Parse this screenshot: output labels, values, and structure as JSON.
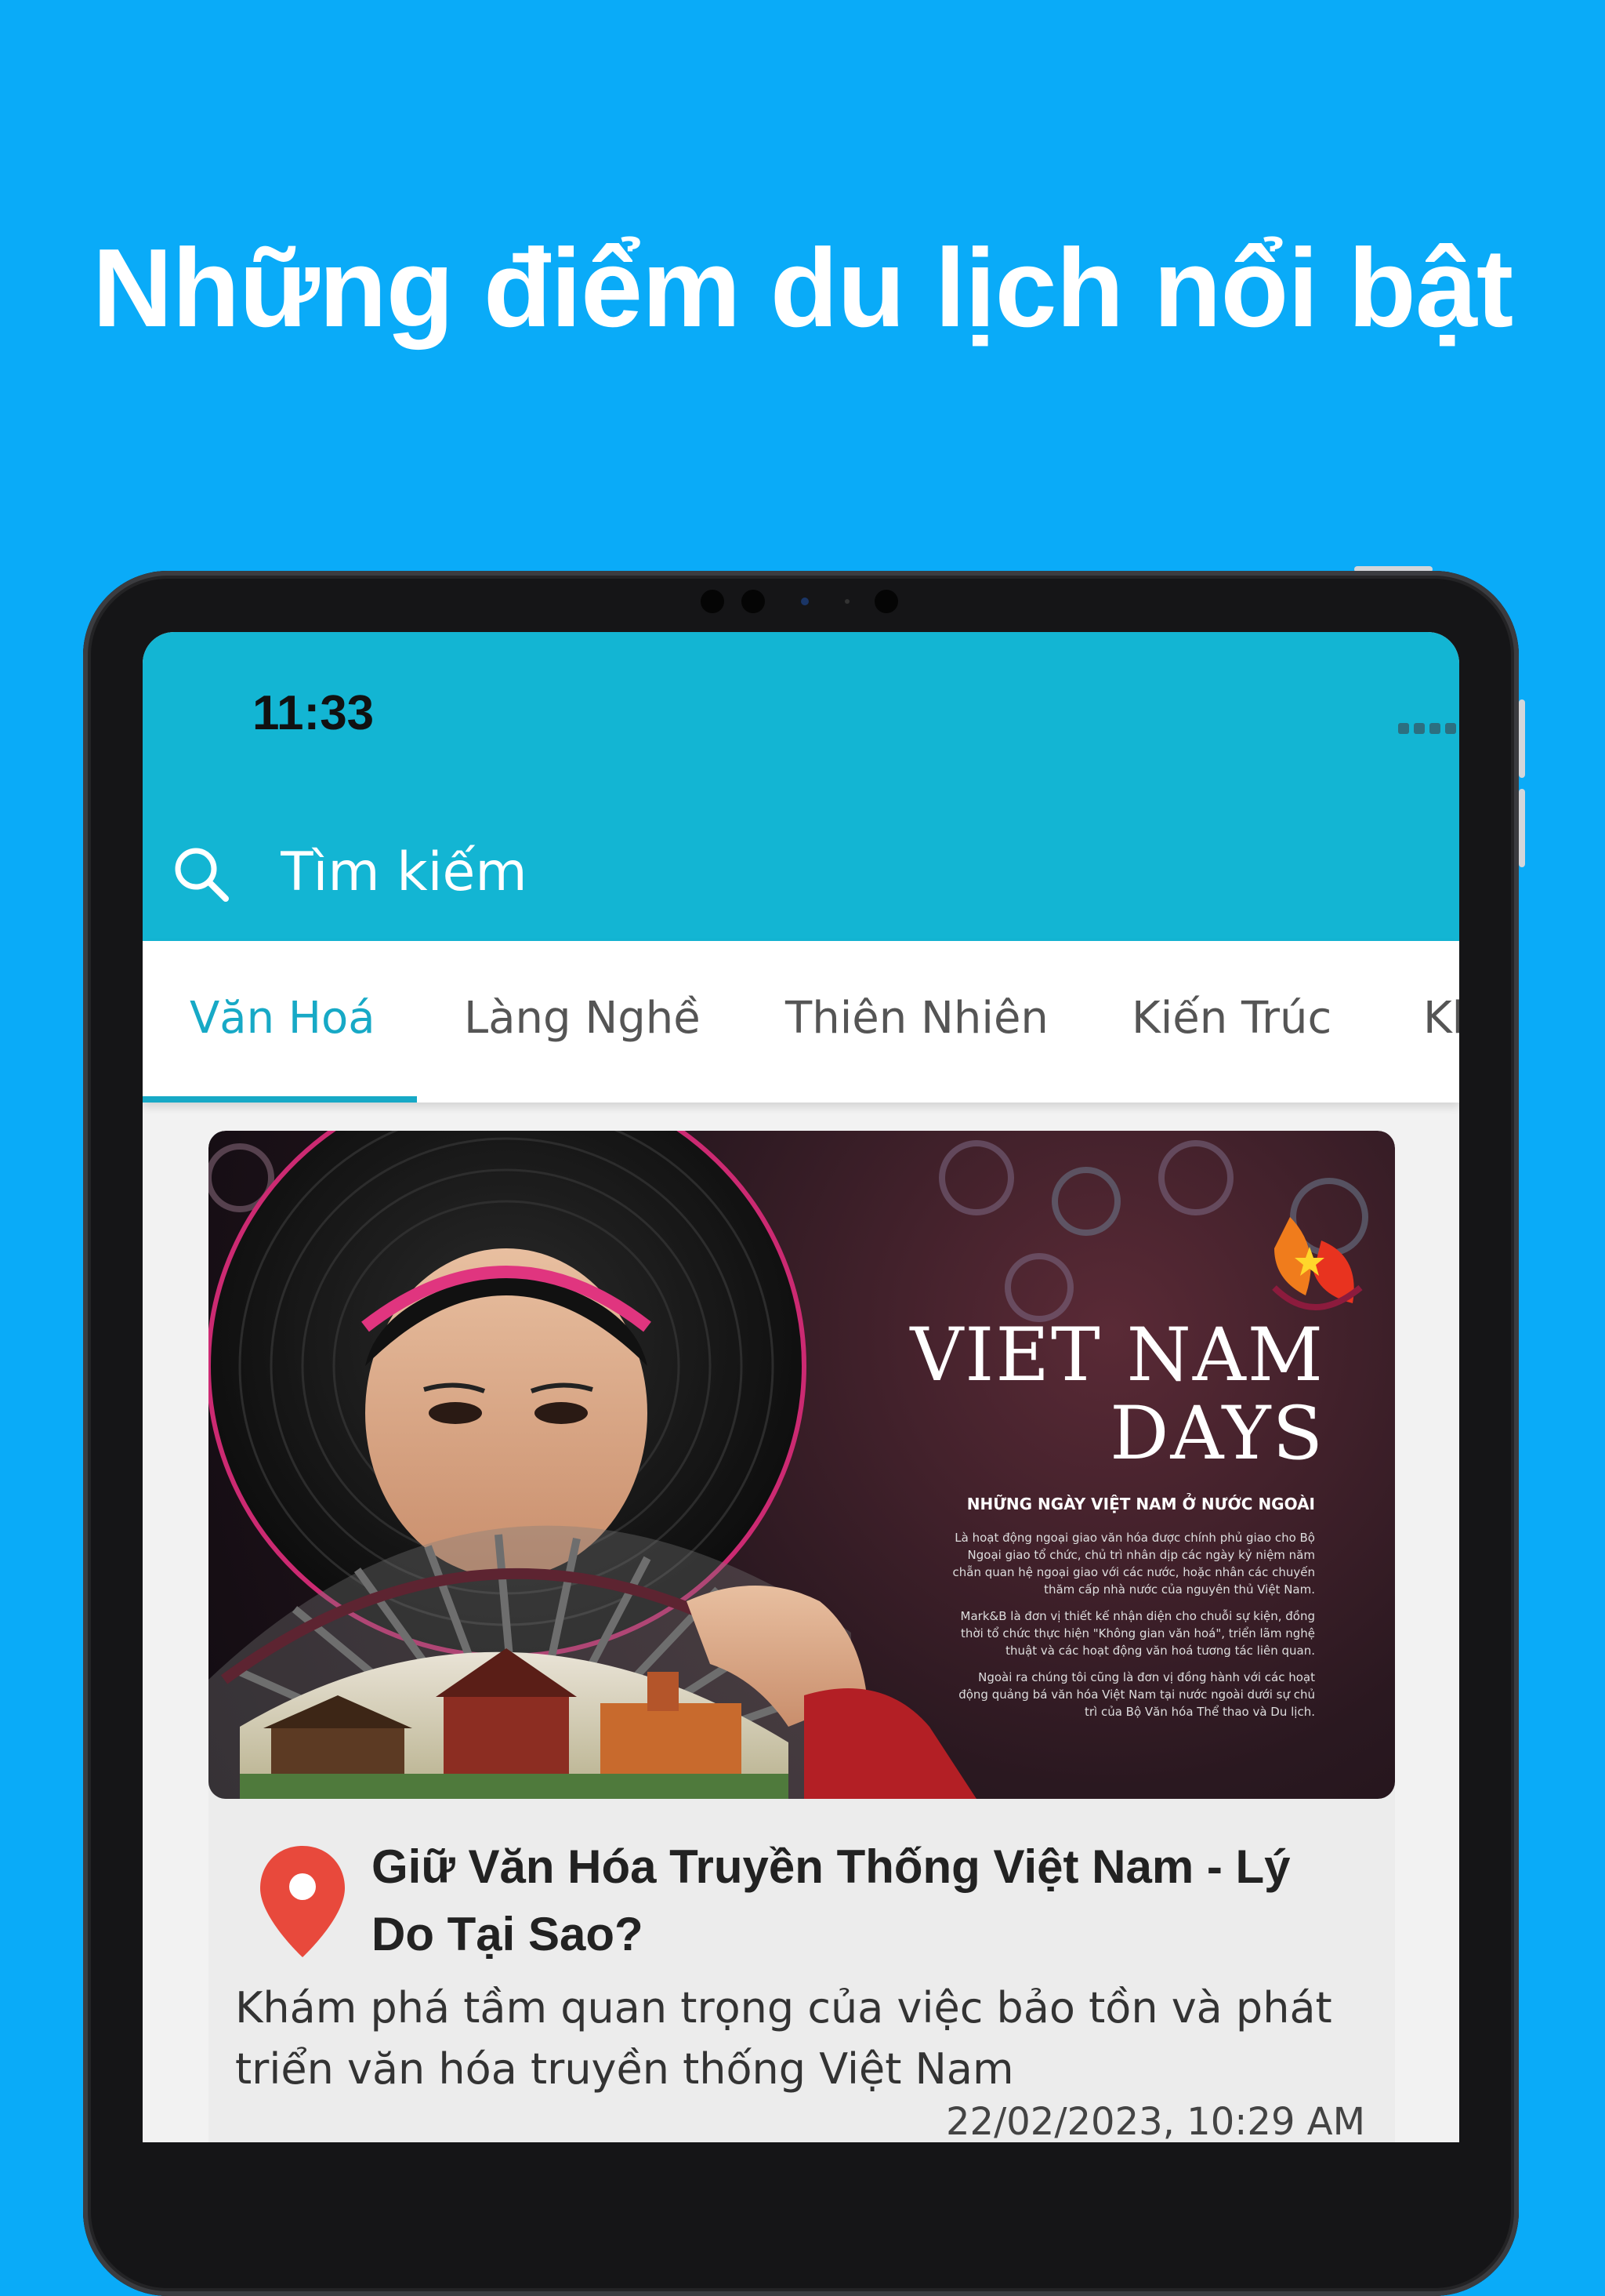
{
  "headline": "Những điểm du lịch nổi bật",
  "status_bar": {
    "time": "11:33"
  },
  "search": {
    "placeholder": "Tìm kiếm"
  },
  "tabs": [
    {
      "label": "Văn Hoá",
      "active": true
    },
    {
      "label": "Làng Nghề",
      "active": false
    },
    {
      "label": "Thiên Nhiên",
      "active": false
    },
    {
      "label": "Kiến Trúc",
      "active": false
    },
    {
      "label": "Kh",
      "active": false
    }
  ],
  "card": {
    "image": {
      "title_line1": "VIET NAM",
      "title_line2": "DAYS",
      "subtitle": "NHỮNG NGÀY VIỆT NAM Ở NƯỚC NGOÀI",
      "paragraphs": [
        "Là hoạt động ngoại giao văn hóa được chính phủ giao cho Bộ Ngoại giao tổ chức, chủ trì nhân dịp các ngày kỷ niệm năm chẵn quan hệ ngoại giao với các nước, hoặc nhân các chuyến thăm cấp nhà nước của nguyên thủ Việt Nam.",
        "Mark&B là đơn vị thiết kế nhận diện cho chuỗi sự kiện, đồng thời tổ chức thực hiện \"Không gian văn hoá\", triển lãm nghệ thuật và các hoạt động văn hoá tương tác liên quan.",
        "Ngoài ra chúng tôi cũng là đơn vị đồng hành với các hoạt động quảng bá văn hóa Việt Nam tại nước ngoài dưới sự chủ trì của Bộ Văn hóa Thể thao và Du lịch."
      ]
    },
    "title": "Giữ Văn Hóa Truyền Thống Việt Nam - Lý Do Tại Sao?",
    "description": "Khám phá tầm quan trọng của việc bảo tồn và phát triển văn hóa truyền thống Việt Nam",
    "date": "22/02/2023, 10:29 AM"
  },
  "colors": {
    "background": "#0aabf8",
    "app_bar": "#13b5d3",
    "tab_active": "#17a9c6",
    "pin": "#e8493c"
  },
  "icons": [
    "search-icon",
    "wifi-icon",
    "battery-icon",
    "location-pin-icon"
  ]
}
